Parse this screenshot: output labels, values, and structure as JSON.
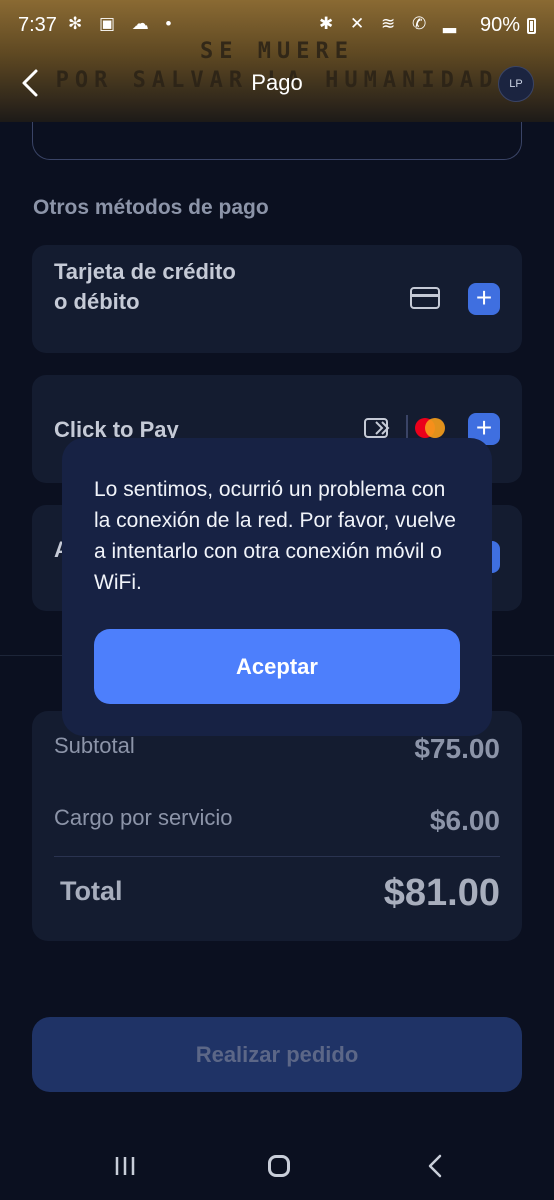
{
  "status_bar": {
    "time": "7:37",
    "left_icons": [
      "fan-icon",
      "gallery-icon",
      "cloud-icon",
      "dot-icon"
    ],
    "right_icons": [
      "bluetooth-icon",
      "mute-icon",
      "wifi-icon",
      "wifi-calling-icon",
      "signal-icon"
    ],
    "battery": "90%"
  },
  "header": {
    "banner_line1": "SE MUERE",
    "banner_line2": "POR SALVAR LA HUMANIDAD",
    "title": "Pago",
    "avatar_initials": "LP"
  },
  "payment": {
    "section_title": "Otros métodos de pago",
    "methods": [
      {
        "label": "Tarjeta de crédito o débito",
        "icon": "credit-card-icon"
      },
      {
        "label": "Click to Pay",
        "icon": "click-to-pay-icon"
      },
      {
        "label": "A",
        "icon": "wallet-icon"
      }
    ]
  },
  "summary": {
    "subtotal_label": "Subtotal",
    "subtotal_value": "$75.00",
    "fee_label": "Cargo por servicio",
    "fee_value": "$6.00",
    "total_label": "Total",
    "total_value": "$81.00"
  },
  "order_button": "Realizar pedido",
  "dialog": {
    "message": "Lo sentimos, ocurrió un problema con la conexión de la red. Por favor, vuelve a intentarlo con otra conexión móvil o WiFi.",
    "accept_label": "Aceptar"
  },
  "colors": {
    "accent": "#4d7ffc",
    "dialog_bg": "#172244",
    "background": "#0b1020"
  }
}
